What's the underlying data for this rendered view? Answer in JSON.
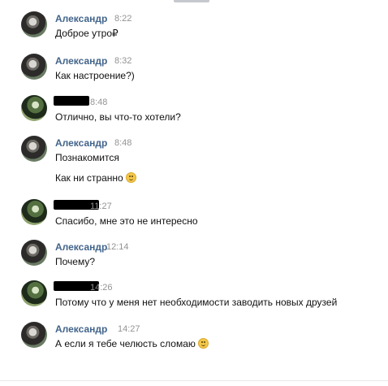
{
  "messages": [
    {
      "name": "Александр",
      "time": "8:22",
      "text": "Доброе утро₽"
    },
    {
      "name": "Александр",
      "time": "8:32",
      "text": "Как настроение?)"
    },
    {
      "name": "",
      "time": "8:48",
      "text": "Отлично, вы что-то хотели?"
    },
    {
      "name": "Александр",
      "time": "8:48",
      "text": "Познакомится",
      "text2": "Как ни странно"
    },
    {
      "name": "",
      "time": "11:27",
      "text": "Спасибо, мне это не интересно"
    },
    {
      "name": "Александр",
      "time": "12:14",
      "text": "Почему?"
    },
    {
      "name": "",
      "time": "14:26",
      "text": "Потому что у меня нет необходимости заводить новых друзей"
    },
    {
      "name": "Александр",
      "time": "14:27",
      "text": "А если я тебе челюсть сломаю"
    }
  ],
  "icons": {
    "avatar_alex": "user-avatar-alexander",
    "avatar_other": "user-avatar-redacted",
    "emoji": "smile-emoji"
  },
  "colors": {
    "name": "#42648b",
    "time": "#939393",
    "text": "#111111"
  }
}
